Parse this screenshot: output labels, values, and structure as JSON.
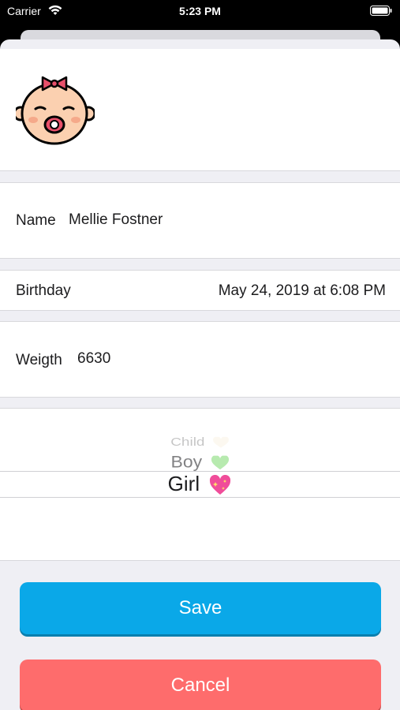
{
  "status_bar": {
    "carrier": "Carrier",
    "time": "5:23 PM",
    "wifi_icon": "wifi-icon",
    "battery_icon": "battery-icon"
  },
  "avatar": {
    "icon": "baby-girl-icon"
  },
  "form": {
    "name_label": "Name",
    "name_value": "Mellie Fostner",
    "birthday_label": "Birthday",
    "birthday_value": "May 24, 2019 at 6:08 PM",
    "weight_label": "Weigth",
    "weight_value": "6630"
  },
  "gender_picker": {
    "options": [
      {
        "label": "Child",
        "emoji": "heart-white-icon"
      },
      {
        "label": "Boy",
        "emoji": "heart-green-icon"
      },
      {
        "label": "Girl",
        "emoji": "sparkling-heart-icon"
      }
    ],
    "selected": "Girl"
  },
  "actions": {
    "save_label": "Save",
    "cancel_label": "Cancel"
  },
  "colors": {
    "save": "#0aa8e8",
    "cancel": "#fe6c6c",
    "background": "#efeff4"
  }
}
